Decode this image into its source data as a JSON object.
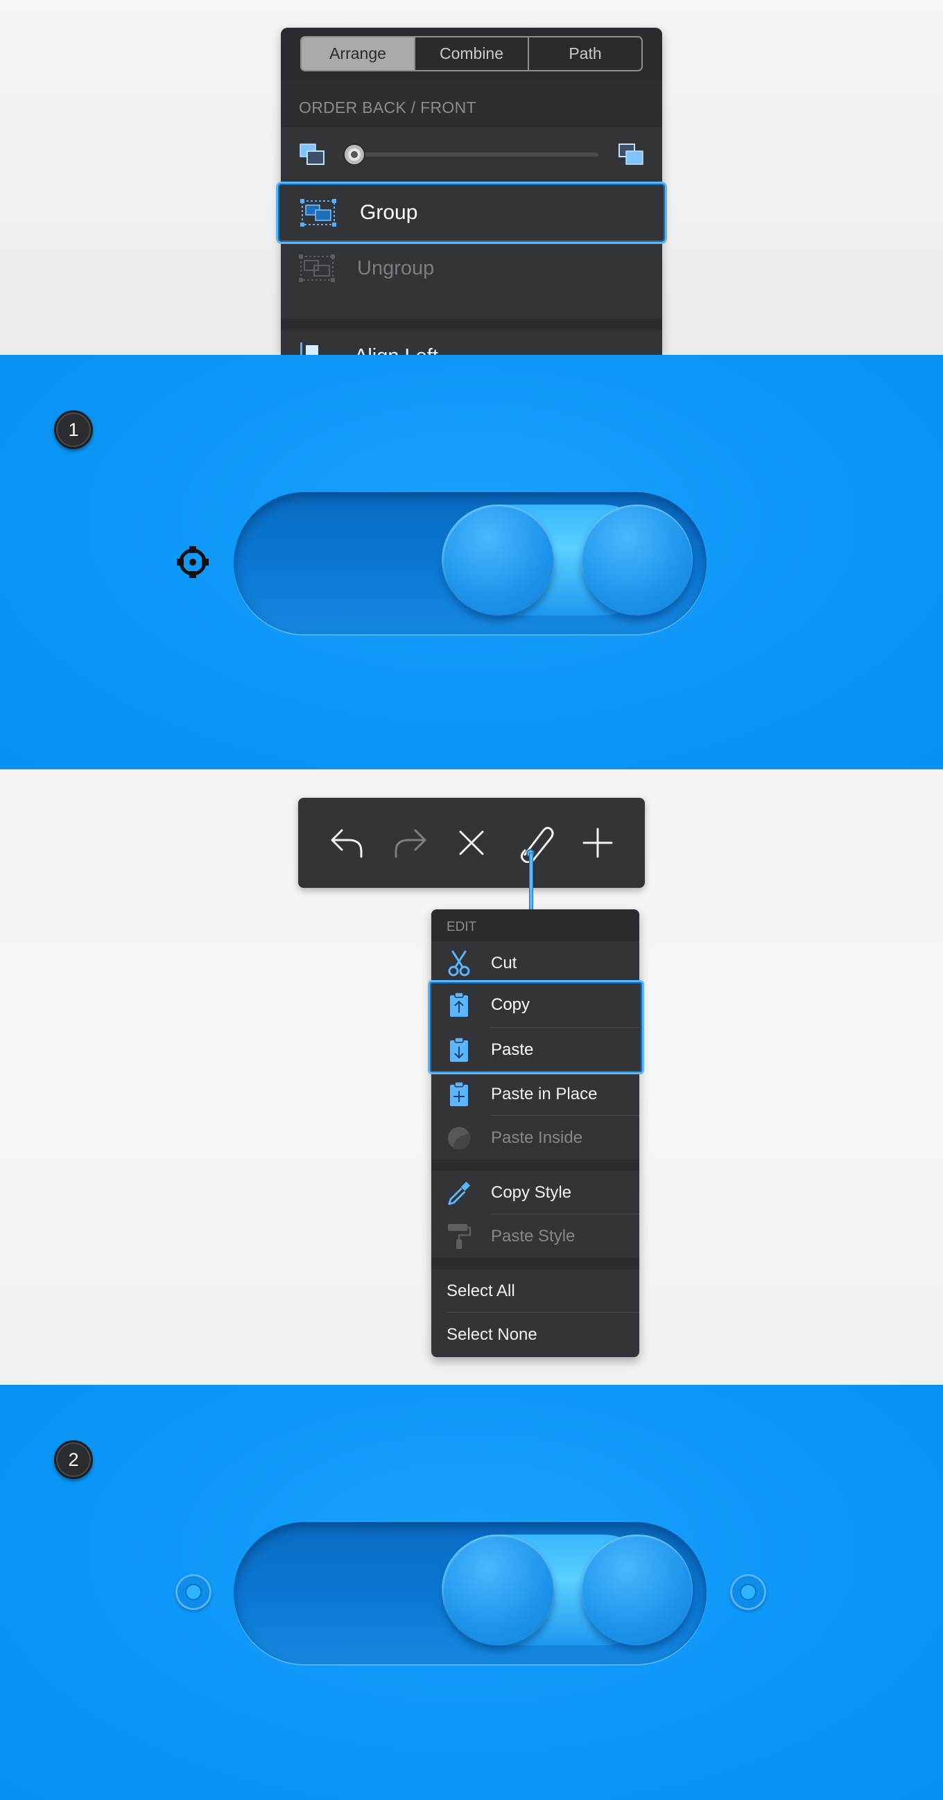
{
  "arrange_panel": {
    "tabs": [
      {
        "label": "Arrange",
        "active": true
      },
      {
        "label": "Combine",
        "active": false
      },
      {
        "label": "Path",
        "active": false
      }
    ],
    "section_label": "ORDER BACK / FRONT",
    "order_slider_value": 0,
    "items": [
      {
        "label": "Group",
        "selected": true,
        "icon": "group-icon"
      },
      {
        "label": "Ungroup",
        "disabled": true,
        "icon": "ungroup-icon"
      },
      {
        "label": "Align Left",
        "icon": "align-left-icon"
      }
    ]
  },
  "steps": [
    {
      "number": "1"
    },
    {
      "number": "2"
    }
  ],
  "toolbar": {
    "buttons": [
      "undo-icon",
      "redo-icon",
      "close-icon",
      "paperclip-icon",
      "plus-icon"
    ]
  },
  "edit_menu": {
    "header": "EDIT",
    "items": [
      {
        "label": "Cut",
        "icon": "scissors-icon"
      },
      {
        "label": "Copy",
        "icon": "clipboard-up-icon",
        "highlighted": true
      },
      {
        "label": "Paste",
        "icon": "clipboard-down-icon",
        "highlighted": true
      },
      {
        "label": "Paste in Place",
        "icon": "clipboard-plus-icon"
      },
      {
        "label": "Paste Inside",
        "icon": "mask-icon",
        "disabled": true
      },
      {
        "label": "Copy Style",
        "icon": "eyedropper-icon"
      },
      {
        "label": "Paste Style",
        "icon": "paint-roller-icon",
        "disabled": true
      },
      {
        "label": "Select All"
      },
      {
        "label": "Select None"
      }
    ]
  },
  "colors": {
    "accent_blue": "#0a96f4",
    "selection_outline": "#5ab6ff",
    "panel_dark": "#333438"
  }
}
